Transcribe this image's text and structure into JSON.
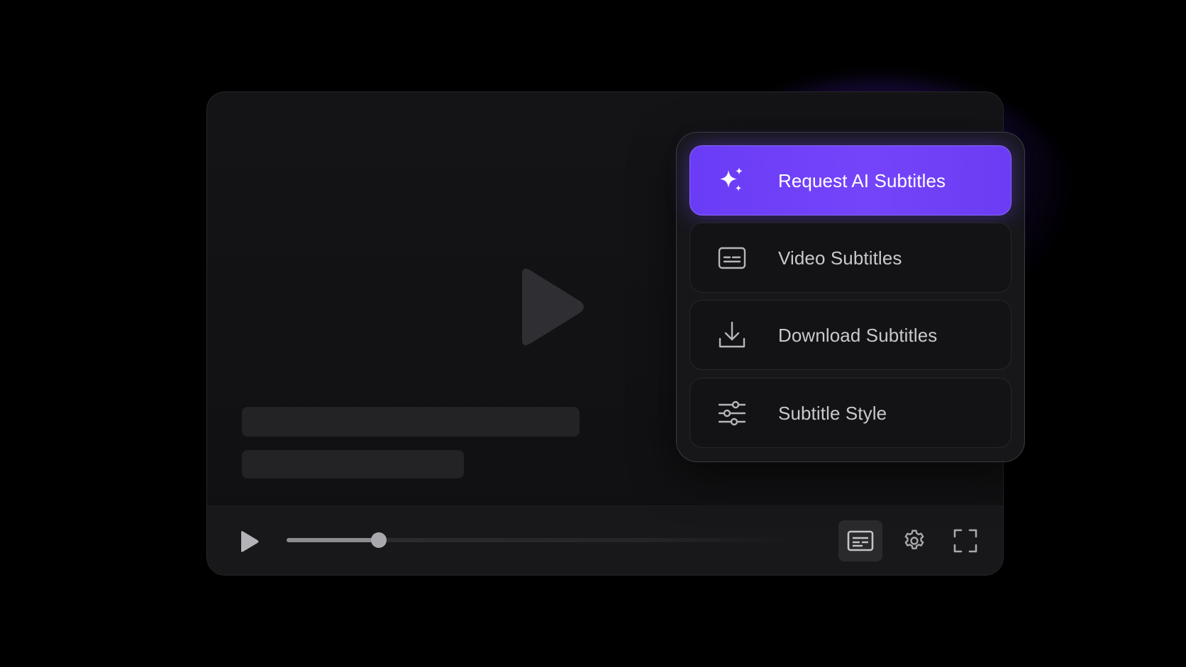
{
  "player": {
    "progress_fraction": 0.18,
    "controls": {
      "play_icon": "play-icon",
      "subtitles_icon": "closed-captions-icon",
      "settings_icon": "gear-icon",
      "fullscreen_icon": "fullscreen-icon"
    }
  },
  "subtitle_menu": {
    "items": [
      {
        "label": "Request AI Subtitles",
        "icon": "sparkles-icon",
        "active": true
      },
      {
        "label": "Video Subtitles",
        "icon": "subtitles-icon",
        "active": false
      },
      {
        "label": "Download Subtitles",
        "icon": "download-icon",
        "active": false
      },
      {
        "label": "Subtitle Style",
        "icon": "sliders-icon",
        "active": false
      }
    ]
  },
  "colors": {
    "accent": "#7041f8",
    "background": "#000000",
    "panel": "#141416"
  }
}
